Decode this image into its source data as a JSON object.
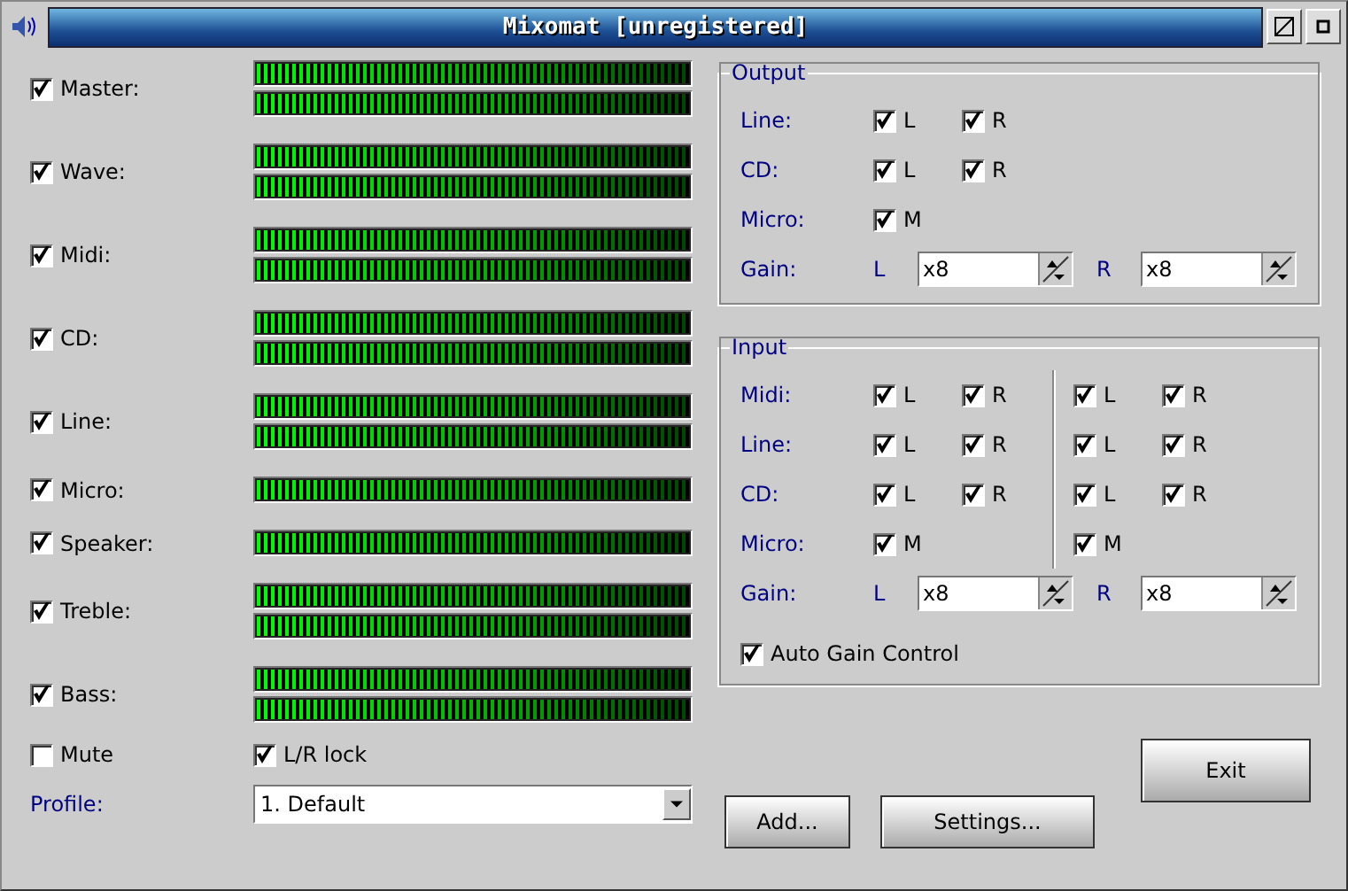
{
  "window": {
    "title": "Mixomat [unregistered]"
  },
  "channels": [
    {
      "label": "Master:",
      "checked": true,
      "bars": [
        {
          "level": 1
        },
        {
          "level": 1
        }
      ]
    },
    {
      "label": "Wave:",
      "checked": true,
      "bars": [
        {
          "level": 1
        },
        {
          "level": 1
        }
      ]
    },
    {
      "label": "Midi:",
      "checked": true,
      "bars": [
        {
          "level": 1
        },
        {
          "level": 1
        }
      ]
    },
    {
      "label": "CD:",
      "checked": true,
      "bars": [
        {
          "level": 1
        },
        {
          "level": 1
        }
      ]
    },
    {
      "label": "Line:",
      "checked": true,
      "bars": [
        {
          "level": 1
        },
        {
          "level": 1
        }
      ]
    },
    {
      "label": "Micro:",
      "checked": true,
      "bars": [
        {
          "level": 1
        }
      ]
    },
    {
      "label": "Speaker:",
      "checked": true,
      "bars": [
        {
          "level": 1
        }
      ]
    },
    {
      "label": "Treble:",
      "checked": true,
      "bars": [
        {
          "level": 1
        },
        {
          "level": 1
        }
      ]
    },
    {
      "label": "Bass:",
      "checked": true,
      "bars": [
        {
          "level": 1
        },
        {
          "level": 1
        }
      ]
    }
  ],
  "output": {
    "title": "Output",
    "rows": [
      {
        "label": "Line:",
        "checks": [
          [
            {
              "label": "L",
              "checked": true
            },
            {
              "label": "R",
              "checked": true
            }
          ]
        ]
      },
      {
        "label": "CD:",
        "checks": [
          [
            {
              "label": "L",
              "checked": true
            },
            {
              "label": "R",
              "checked": true
            }
          ]
        ]
      },
      {
        "label": "Micro:",
        "checks": [
          [
            {
              "label": "M",
              "checked": true
            }
          ]
        ]
      }
    ],
    "gain": {
      "label": "Gain:",
      "left": {
        "label": "L",
        "value": "x8"
      },
      "right": {
        "label": "R",
        "value": "x8"
      }
    }
  },
  "input": {
    "title": "Input",
    "rows": [
      {
        "label": "Midi:",
        "checks": [
          [
            {
              "label": "L",
              "checked": true
            },
            {
              "label": "R",
              "checked": true
            }
          ],
          [
            {
              "label": "L",
              "checked": true
            },
            {
              "label": "R",
              "checked": true
            }
          ]
        ]
      },
      {
        "label": "Line:",
        "checks": [
          [
            {
              "label": "L",
              "checked": true
            },
            {
              "label": "R",
              "checked": true
            }
          ],
          [
            {
              "label": "L",
              "checked": true
            },
            {
              "label": "R",
              "checked": true
            }
          ]
        ]
      },
      {
        "label": "CD:",
        "checks": [
          [
            {
              "label": "L",
              "checked": true
            },
            {
              "label": "R",
              "checked": true
            }
          ],
          [
            {
              "label": "L",
              "checked": true
            },
            {
              "label": "R",
              "checked": true
            }
          ]
        ]
      },
      {
        "label": "Micro:",
        "checks": [
          [
            {
              "label": "M",
              "checked": true
            }
          ],
          [
            {
              "label": "M",
              "checked": true
            }
          ]
        ]
      }
    ],
    "gain": {
      "label": "Gain:",
      "left": {
        "label": "L",
        "value": "x8"
      },
      "right": {
        "label": "R",
        "value": "x8"
      }
    },
    "auto_gain": {
      "label": "Auto Gain Control",
      "checked": true
    }
  },
  "mute": {
    "label": "Mute",
    "checked": false
  },
  "lr_lock": {
    "label": "L/R lock",
    "checked": true
  },
  "profile": {
    "label": "Profile:",
    "value": "1. Default"
  },
  "buttons": {
    "add": "Add...",
    "settings": "Settings...",
    "exit": "Exit"
  }
}
